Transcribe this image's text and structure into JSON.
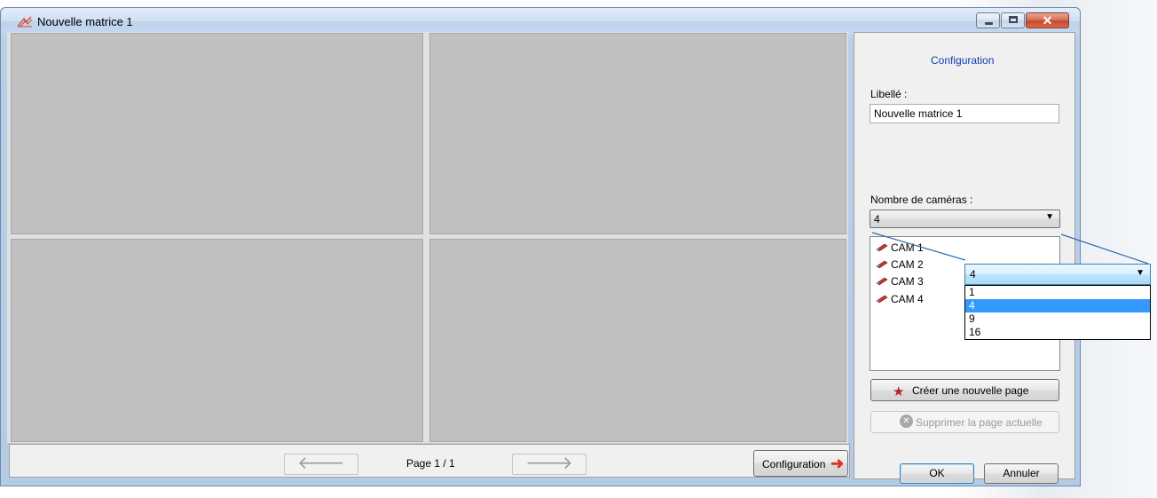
{
  "window": {
    "title": "Nouvelle matrice 1"
  },
  "nav": {
    "page_label": "Page 1 / 1",
    "prev_icon": "arrow-left-icon",
    "next_icon": "arrow-right-icon",
    "config_label": "Configuration"
  },
  "panel": {
    "title": "Configuration",
    "libelle_label": "Libellé :",
    "libelle_value": "Nouvelle matrice 1",
    "nb_cameras_label": "Nombre de caméras :",
    "nb_cameras_value": "4",
    "cameras": [
      "CAM 1",
      "CAM 2",
      "CAM 3",
      "CAM 4"
    ],
    "create_page_label": "Créer une nouvelle page",
    "delete_page_label": "Supprimer la page actuelle",
    "ok_label": "OK",
    "cancel_label": "Annuler"
  },
  "zoom_dropdown": {
    "value": "4",
    "options": [
      "1",
      "4",
      "9",
      "16"
    ],
    "selected_index": 1
  },
  "colors": {
    "accent_link": "#0b3eb5",
    "selection": "#3399ff",
    "arrow_red": "#e0311c"
  }
}
